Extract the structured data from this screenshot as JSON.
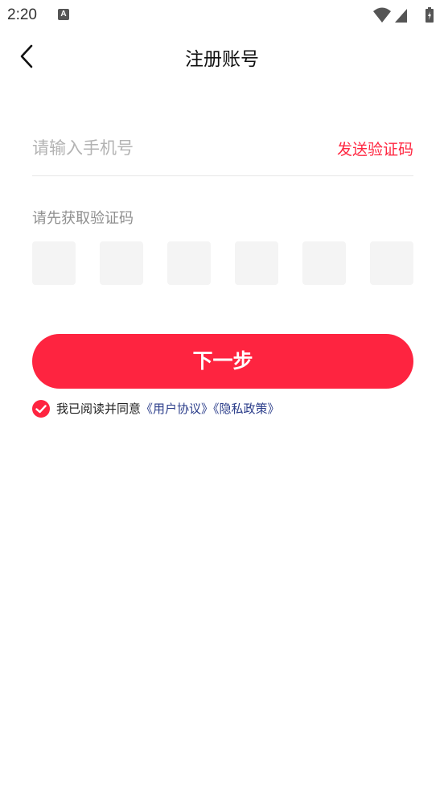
{
  "status_bar": {
    "time": "2:20",
    "notification_icon": "A"
  },
  "header": {
    "title": "注册账号",
    "back_icon": "chevron-left-icon"
  },
  "phone": {
    "placeholder": "请输入手机号",
    "value": "",
    "send_code_label": "发送验证码"
  },
  "code": {
    "hint": "请先获取验证码",
    "digits": [
      "",
      "",
      "",
      "",
      "",
      ""
    ]
  },
  "next_button": {
    "label": "下一步"
  },
  "agreement": {
    "checked": true,
    "prefix": "我已阅读并同意",
    "user_agreement": "《用户协议》",
    "privacy_policy": "《隐私政策》"
  },
  "colors": {
    "accent": "#fe2440",
    "link": "#2b3d8a",
    "placeholder": "#b3b3b3",
    "box_bg": "#f4f4f4"
  }
}
